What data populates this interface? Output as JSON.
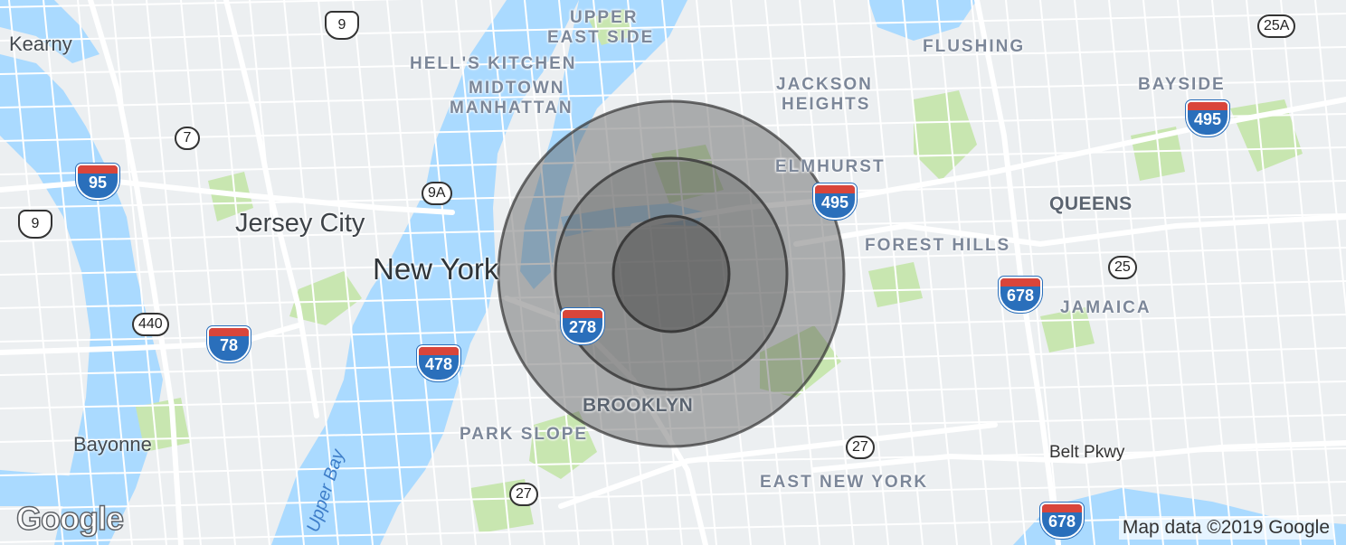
{
  "map": {
    "colors": {
      "land": "#eceff1",
      "water": "#aadaff",
      "park": "#c8e6b0",
      "road": "#ffffff",
      "radius_fill": "#5a5a5a",
      "radius_stroke": "#333333"
    },
    "labels": {
      "upper_east_side_1": "UPPER",
      "upper_east_side_2": "EAST SIDE",
      "hells_kitchen": "HELL'S KITCHEN",
      "midtown_1": "MIDTOWN",
      "midtown_2": "MANHATTAN",
      "flushing": "FLUSHING",
      "jackson_heights_1": "JACKSON",
      "jackson_heights_2": "HEIGHTS",
      "bayside": "BAYSIDE",
      "elmhurst": "ELMHURST",
      "queens": "QUEENS",
      "forest_hills": "FOREST HILLS",
      "jamaica": "JAMAICA",
      "brooklyn": "BROOKLYN",
      "park_slope": "PARK SLOPE",
      "east_new_york": "EAST NEW YORK",
      "kearny": "Kearny",
      "jersey_city": "Jersey City",
      "new_york": "New York",
      "bayonne": "Bayonne",
      "belt_pkwy": "Belt Pkwy",
      "upper_bay": "Upper Bay"
    },
    "shields": {
      "us_9_top": "9",
      "us_9_left": "9",
      "nj_7": "7",
      "nj_9a": "9A",
      "nj_440": "440",
      "ny_25a": "25A",
      "ny_25": "25",
      "ny_27_east": "27",
      "ny_27_south": "27",
      "i95": "95",
      "i78": "78",
      "i478": "478",
      "i278": "278",
      "i495_elmhurst": "495",
      "i495_bayside": "495",
      "i678_jamaica": "678",
      "i678_bottom": "678"
    },
    "radius_rings": [
      {
        "ring": "outer"
      },
      {
        "ring": "middle"
      },
      {
        "ring": "inner"
      }
    ],
    "logo": "Google",
    "attribution": "Map data ©2019 Google"
  }
}
